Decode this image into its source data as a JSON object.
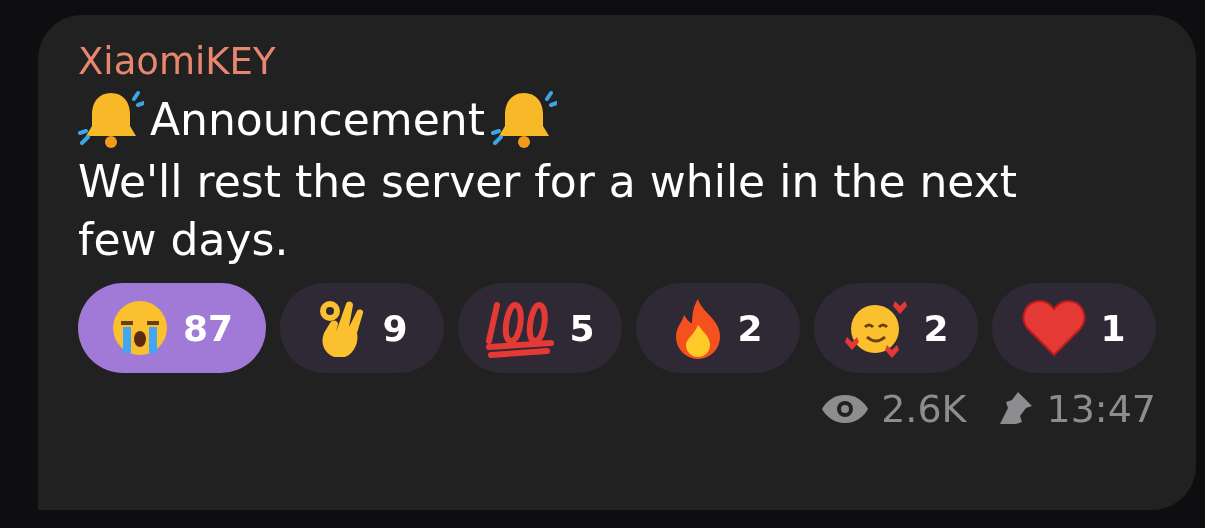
{
  "message": {
    "author": "XiaomiKEY",
    "title": "Announcement",
    "body": "We'll rest the server for a while in the next few days.",
    "reactions": [
      {
        "kind": "crying",
        "count": "87",
        "selected": true
      },
      {
        "kind": "ok",
        "count": "9",
        "selected": false
      },
      {
        "kind": "hundred",
        "count": "5",
        "selected": false
      },
      {
        "kind": "fire",
        "count": "2",
        "selected": false
      },
      {
        "kind": "hearts-face",
        "count": "2",
        "selected": false
      },
      {
        "kind": "heart",
        "count": "1",
        "selected": false
      }
    ],
    "views": "2.6K",
    "pinned": true,
    "time": "13:47"
  }
}
